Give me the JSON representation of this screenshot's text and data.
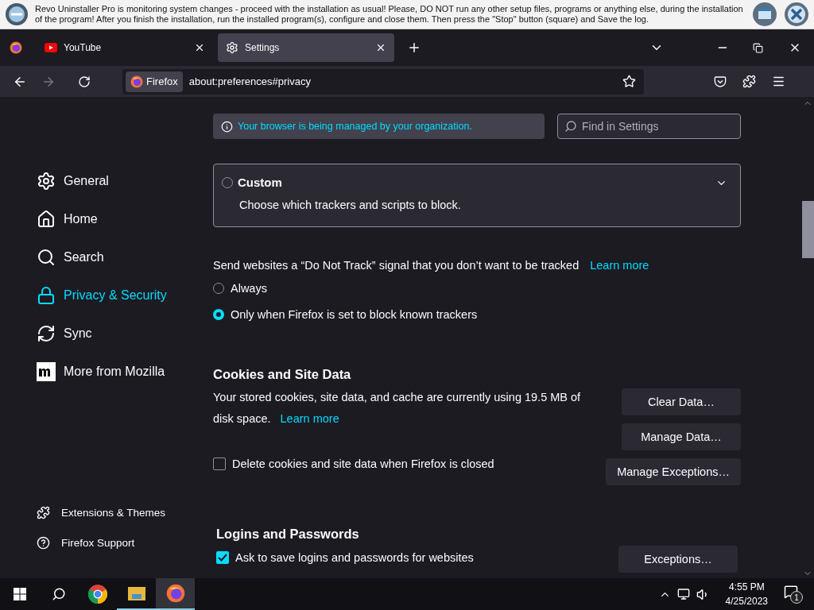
{
  "notification_bar": {
    "message": "Revo Uninstaller Pro is monitoring system changes - proceed with the installation as usual! Please, DO NOT run any other setup files, programs or anything else, during the installation of the program! After you finish the installation, run the installed program(s), configure and close them. Then press the \"Stop\" button (square) and Save the log."
  },
  "tabs": [
    {
      "label": "YouTube",
      "kind": "youtube",
      "selected": false
    },
    {
      "label": "Settings",
      "kind": "settings",
      "selected": true
    }
  ],
  "address_bar": {
    "identity": "Firefox",
    "url": "about:preferences#privacy"
  },
  "sidebar": {
    "items": [
      {
        "label": "General",
        "selected": false
      },
      {
        "label": "Home",
        "selected": false
      },
      {
        "label": "Search",
        "selected": false
      },
      {
        "label": "Privacy & Security",
        "selected": true
      },
      {
        "label": "Sync",
        "selected": false
      },
      {
        "label": "More from Mozilla",
        "selected": false
      }
    ],
    "footer_links": [
      "Extensions & Themes",
      "Firefox Support"
    ]
  },
  "managed_notice": "Your browser is being managed by your organization.",
  "search": {
    "placeholder": "Find in Settings"
  },
  "custom_option": {
    "title": "Custom",
    "description": "Choose which trackers and scripts to block.",
    "selected": false
  },
  "do_not_track": {
    "label": "Send websites a “Do Not Track” signal that you don’t want to be tracked",
    "link": "Learn more",
    "options": [
      {
        "label": "Always",
        "selected": false
      },
      {
        "label": "Only when Firefox is set to block known trackers",
        "selected": true
      }
    ]
  },
  "cookies": {
    "heading": "Cookies and Site Data",
    "description": "Your stored cookies, site data, and cache are currently using 19.5 MB of disk space.",
    "link": "Learn more",
    "delete_on_close": {
      "label": "Delete cookies and site data when Firefox is closed",
      "checked": false
    },
    "buttons": [
      "Clear Data…",
      "Manage Data…",
      "Manage Exceptions…"
    ]
  },
  "logins": {
    "heading": "Logins and Passwords",
    "ask_to_save": {
      "label": "Ask to save logins and passwords for websites",
      "checked": true
    },
    "buttons": [
      "Exceptions…"
    ]
  },
  "taskbar": {
    "time": "4:55 PM",
    "date": "4/25/2023",
    "notifications": "1"
  }
}
